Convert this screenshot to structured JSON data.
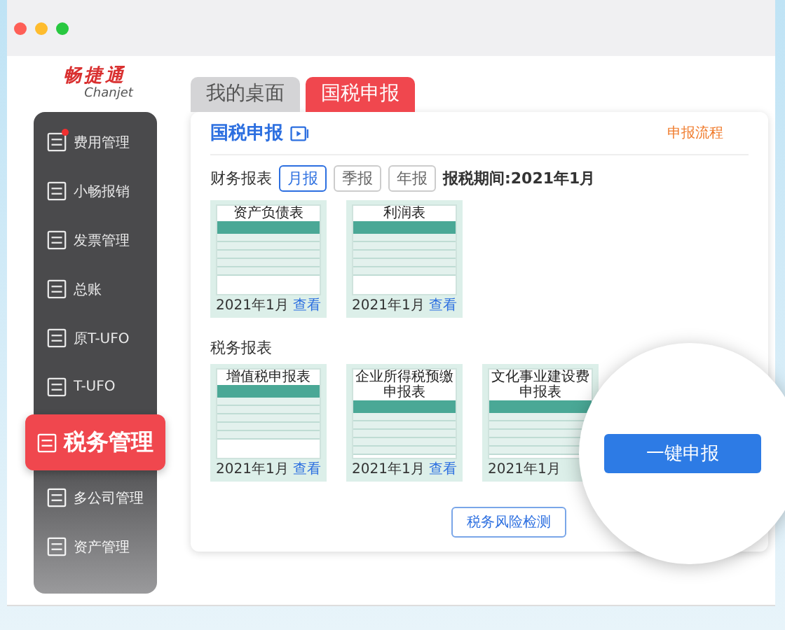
{
  "logo": {
    "name": "畅捷通",
    "sub": "Chanjet"
  },
  "sidebar": {
    "items": [
      {
        "label": "费用管理",
        "selected": false,
        "badge": true
      },
      {
        "label": "小畅报销",
        "selected": false,
        "badge": false
      },
      {
        "label": "发票管理",
        "selected": false,
        "badge": false
      },
      {
        "label": "总账",
        "selected": false,
        "badge": false
      },
      {
        "label": "原T-UFO",
        "selected": false,
        "badge": false
      },
      {
        "label": "T-UFO",
        "selected": false,
        "badge": false
      },
      {
        "label": "税务管理",
        "selected": true,
        "badge": false
      },
      {
        "label": "多公司管理",
        "selected": false,
        "badge": false
      },
      {
        "label": "资产管理",
        "selected": false,
        "badge": false
      }
    ]
  },
  "tabs": [
    {
      "label": "我的桌面",
      "selected": false
    },
    {
      "label": "国税申报",
      "selected": true
    }
  ],
  "panel": {
    "title": "国税申报",
    "link": "申报流程",
    "period_row": {
      "label": "财务报表",
      "options": [
        {
          "label": "月报",
          "selected": true
        },
        {
          "label": "季报",
          "selected": false
        },
        {
          "label": "年报",
          "selected": false
        }
      ],
      "period": "报税期间:2021年1月"
    },
    "financial_reports": [
      {
        "kind": "report",
        "title": "资产负债表",
        "date": "2021年1月",
        "link": "查看"
      },
      {
        "kind": "report",
        "title": "利润表",
        "date": "2021年1月",
        "link": "查看"
      }
    ],
    "tax_label": "税务报表",
    "tax_reports": [
      {
        "kind": "report",
        "title": "增值税申报表",
        "date": "2021年1月",
        "link": "查看"
      },
      {
        "kind": "report",
        "title": "企业所得税预缴申报表",
        "date": "2021年1月",
        "link": "查看"
      },
      {
        "kind": "report",
        "title": "文化事业建设费申报表",
        "date": "2021年1月"
      }
    ],
    "buttons": [
      {
        "kind": "outline",
        "label": "税务风险检测"
      }
    ]
  },
  "magnifier": {
    "button": "一键申报"
  }
}
